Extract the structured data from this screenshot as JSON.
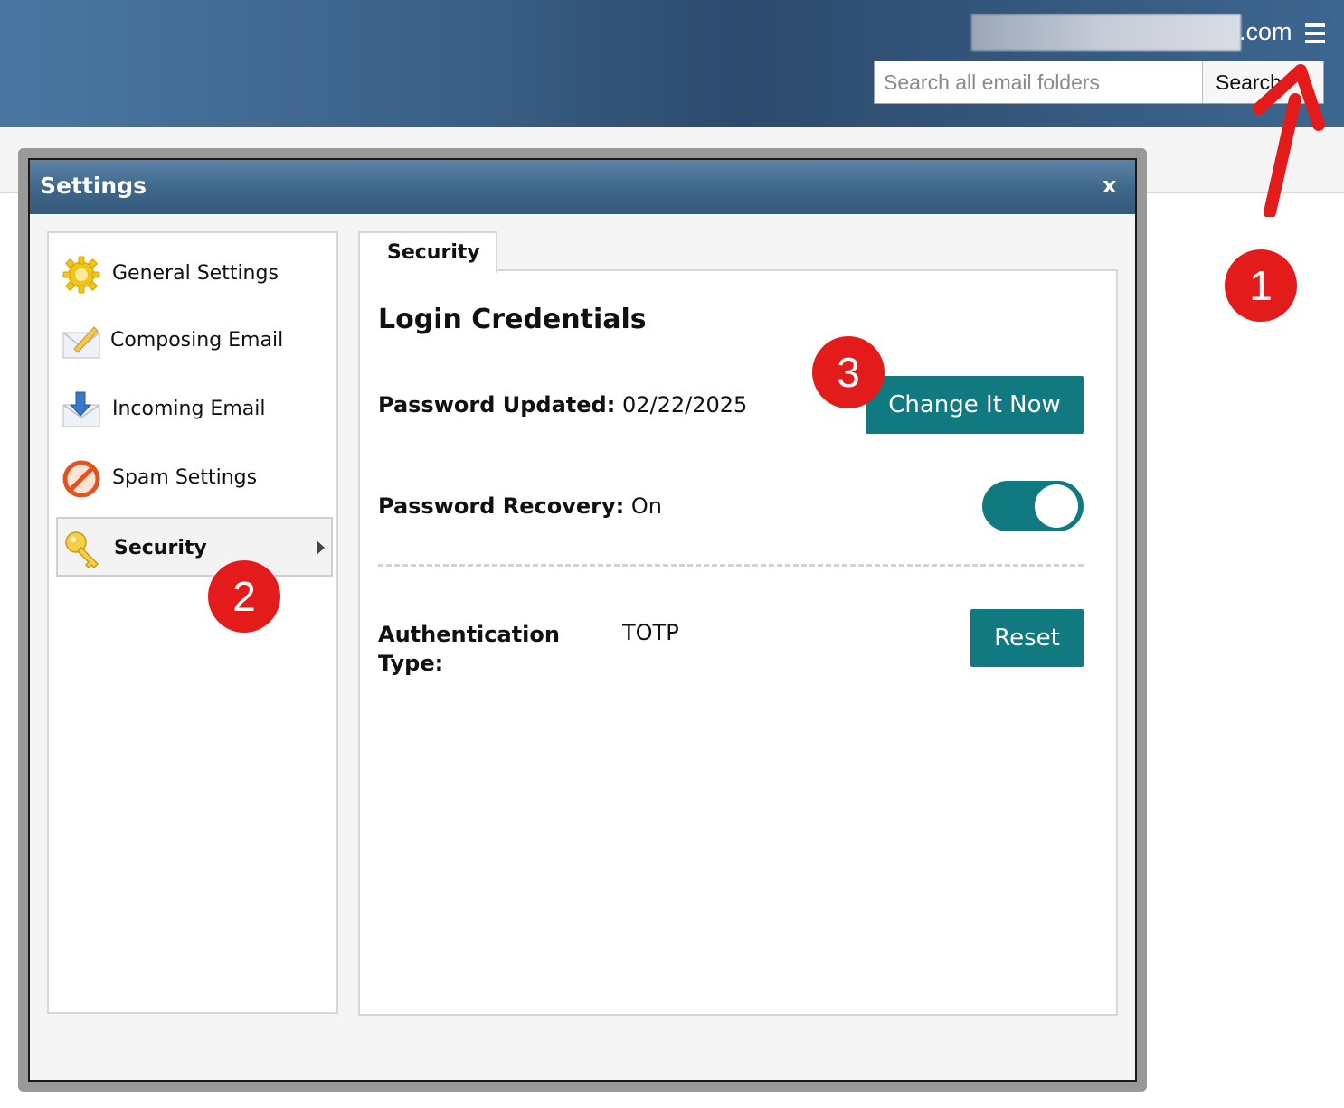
{
  "header": {
    "domain_suffix": ".com",
    "search_placeholder": "Search all email folders",
    "search_value": "",
    "search_button": "Search",
    "menu_icon": "hamburger-icon"
  },
  "modal": {
    "title": "Settings",
    "close_label": "x"
  },
  "sidebar": {
    "items": [
      {
        "label": "General Settings",
        "icon": "gear-icon"
      },
      {
        "label": "Composing Email",
        "icon": "envelope-pencil-icon"
      },
      {
        "label": "Incoming Email",
        "icon": "incoming-envelope-icon"
      },
      {
        "label": "Spam Settings",
        "icon": "no-entry-icon"
      },
      {
        "label": "Security",
        "icon": "key-icon",
        "selected": true
      }
    ]
  },
  "content": {
    "tab_label": "Security",
    "heading": "Login Credentials",
    "password_updated_label": "Password Updated:",
    "password_updated_value": "02/22/2025",
    "change_button": "Change It Now",
    "recovery_label": "Password Recovery:",
    "recovery_value": "On",
    "recovery_toggle_on": true,
    "auth_label_line1": "Authentication",
    "auth_label_line2": "Type:",
    "auth_value": "TOTP",
    "reset_button": "Reset"
  },
  "annotations": {
    "badges": [
      "1",
      "2",
      "3"
    ],
    "badge_color": "#e31b1b"
  },
  "colors": {
    "accent": "#117a80",
    "header": "#2c4a6c"
  }
}
